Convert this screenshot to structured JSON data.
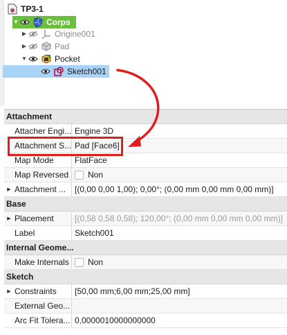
{
  "tree": {
    "root": {
      "label": "TP3-1",
      "icon": "document-icon"
    },
    "body": {
      "label": "Corps",
      "icon": "body-icon",
      "visible": true
    },
    "items": [
      {
        "label": "Origine001",
        "icon": "origin-axes-icon",
        "hidden": true
      },
      {
        "label": "Pad",
        "icon": "pad-icon",
        "hidden": true
      },
      {
        "label": "Pocket",
        "icon": "pocket-icon",
        "hidden": false
      }
    ],
    "selected": {
      "label": "Sketch001",
      "icon": "sketch-icon"
    }
  },
  "properties": {
    "groups": [
      {
        "title": "Attachment",
        "rows": [
          {
            "name": "Attacher Engi...",
            "value": "Engine 3D",
            "expandable": false
          },
          {
            "name": "Attachment S...",
            "value": "Pad [Face6]",
            "expandable": false,
            "highlighted": true
          },
          {
            "name": "Map Mode",
            "value": "FlatFace",
            "expandable": false
          },
          {
            "name": "Map Reversed",
            "value": "Non",
            "checkbox": true,
            "expandable": false
          },
          {
            "name": "Attachment ...",
            "value": "[(0,00 0,00 1,00); 0,00°; (0,00 mm  0,00 mm  0,00 mm)]",
            "expandable": true
          }
        ]
      },
      {
        "title": "Base",
        "rows": [
          {
            "name": "Placement",
            "value": "[(0,58 0,58 0,58); 120,00°; (0,00 mm  0,00 mm  0,00 mm)]",
            "expandable": true,
            "dim": true
          },
          {
            "name": "Label",
            "value": "Sketch001",
            "expandable": false
          }
        ]
      },
      {
        "title": "Internal Geome...",
        "rows": [
          {
            "name": "Make Internals",
            "value": "Non",
            "checkbox": true,
            "expandable": false
          }
        ]
      },
      {
        "title": "Sketch",
        "rows": [
          {
            "name": "Constraints",
            "value": "[50,00 mm;6,00 mm;25,00 mm]",
            "expandable": true
          },
          {
            "name": "External Geo...",
            "value": "",
            "expandable": false
          },
          {
            "name": "Arc Fit Tolera...",
            "value": "0,0000010000000000",
            "expandable": false
          }
        ]
      }
    ]
  },
  "colors": {
    "body_highlight": "#6abf3c",
    "selection": "#a8d3f6",
    "annotation_red": "#e01e1e"
  }
}
